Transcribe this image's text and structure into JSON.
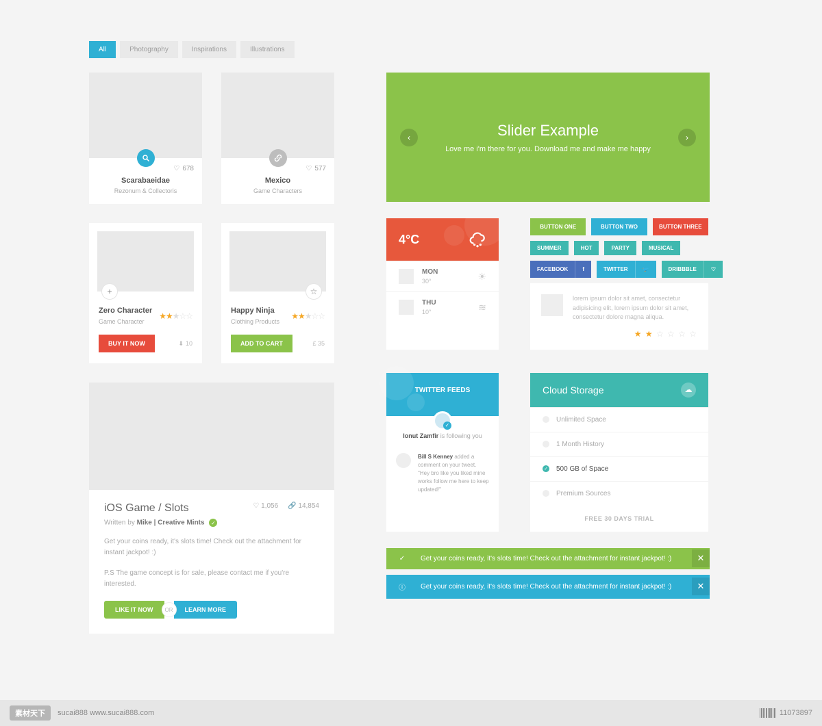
{
  "filters": {
    "all": "All",
    "photography": "Photography",
    "inspirations": "Inspirations",
    "illustrations": "Illustrations"
  },
  "card1": {
    "likes": "678",
    "title": "Scarabaeidae",
    "subtitle": "Rezonum & Collectoris"
  },
  "card2": {
    "likes": "577",
    "title": "Mexico",
    "subtitle": "Game Characters"
  },
  "prod1": {
    "name": "Zero Character",
    "cat": "Game Character",
    "btn": "BUY IT NOW",
    "downloads": "10"
  },
  "prod2": {
    "name": "Happy Ninja",
    "cat": "Clothing Products",
    "btn": "ADD TO CART",
    "price": "£ 35"
  },
  "article": {
    "title": "iOS Game / Slots",
    "author_label": "Written by",
    "author": "Mike | Creative Mints",
    "likes": "1,056",
    "links": "14,854",
    "desc1": "Get your coins ready, it's slots time! Check out the attachment for instant jackpot! :)",
    "desc2": "P.S The game concept is for sale, please contact me if you're interested.",
    "btn1": "LIKE IT NOW",
    "or": "OR",
    "btn2": "LEARN MORE"
  },
  "slider": {
    "title": "Slider Example",
    "subtitle": "Love me i'm there for you. Download me and make me happy"
  },
  "weather": {
    "temp": "4°C",
    "days": [
      {
        "name": "MON",
        "val": "30°"
      },
      {
        "name": "THU",
        "val": "10°"
      }
    ]
  },
  "buttons": {
    "b1": "BUTTON ONE",
    "b2": "BUTTON TWO",
    "b3": "BUTTON THREE",
    "t1": "SUMMER",
    "t2": "HOT",
    "t3": "PARTY",
    "t4": "MUSICAL",
    "fb": "FACEBOOK",
    "tw": "TWITTER",
    "dr": "DRIBBBLE",
    "review": "lorem ipsum dolor sit amet, consectetur adipisicing elit, lorem ipsum dolor sit amet, consectetur dolore magna aliqua."
  },
  "twitter": {
    "header": "TWITTER FEEDS",
    "follow_name": "Ionut Zamfir",
    "follow_txt": "is following you",
    "post_name": "Bill S Kenney",
    "post_action": "added a comment on your tweet.",
    "post_quote": "\"Hey bro like you liked mine works follow me here to keep updated!\""
  },
  "cloud": {
    "title": "Cloud Storage",
    "items": [
      "Unlimited Space",
      "1 Month History",
      "500 GB of Space",
      "Premium Sources"
    ],
    "trial": "FREE 30 DAYS TRIAL"
  },
  "alerts": {
    "a1": "Get your coins ready, it's slots time! Check out the attachment for instant jackpot! :)",
    "a2": "Get your coins ready, it's slots time! Check out the attachment for instant jackpot! :)"
  },
  "footer": {
    "brand": "素材天下",
    "url": "sucai888  www.sucai888.com",
    "id": "11073897"
  }
}
